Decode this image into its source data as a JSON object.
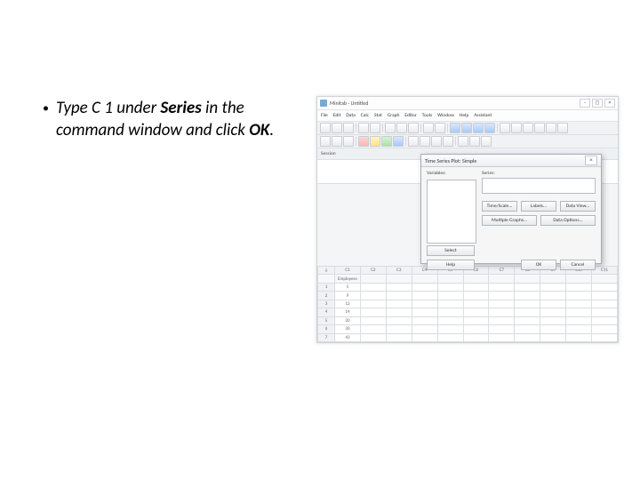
{
  "slide": {
    "bullet": {
      "pre": "Type C 1 under ",
      "bold1": "Series",
      "mid": " in the command window and click ",
      "bold2": "OK",
      "post": "."
    }
  },
  "app": {
    "title": "Minitab - Untitled",
    "menu": [
      "File",
      "Edit",
      "Data",
      "Calc",
      "Stat",
      "Graph",
      "Editor",
      "Tools",
      "Window",
      "Help",
      "Assistant"
    ],
    "session_label": "Session"
  },
  "worksheet": {
    "columns": [
      "C1",
      "C2",
      "C3",
      "C4",
      "C5",
      "C6",
      "C7",
      "C8",
      "C9",
      "C10",
      "C11"
    ],
    "var_names": [
      "Employees",
      "",
      "",
      "",
      "",
      "",
      "",
      "",
      "",
      "",
      ""
    ],
    "rows": [
      [
        "1",
        "5",
        "",
        "",
        "",
        "",
        "",
        "",
        "",
        "",
        "",
        ""
      ],
      [
        "2",
        "9",
        "",
        "",
        "",
        "",
        "",
        "",
        "",
        "",
        "",
        ""
      ],
      [
        "3",
        "12",
        "",
        "",
        "",
        "",
        "",
        "",
        "",
        "",
        "",
        ""
      ],
      [
        "4",
        "14",
        "",
        "",
        "",
        "",
        "",
        "",
        "",
        "",
        "",
        ""
      ],
      [
        "5",
        "20",
        "",
        "",
        "",
        "",
        "",
        "",
        "",
        "",
        "",
        ""
      ],
      [
        "6",
        "30",
        "",
        "",
        "",
        "",
        "",
        "",
        "",
        "",
        "",
        ""
      ],
      [
        "7",
        "43",
        "",
        "",
        "",
        "",
        "",
        "",
        "",
        "",
        "",
        ""
      ]
    ]
  },
  "dialog": {
    "title": "Time Series Plot: Simple",
    "listbox_label": "Variables:",
    "series_label": "Series:",
    "series_value": "",
    "buttons": {
      "timescale": "Time/Scale...",
      "labels": "Labels...",
      "dataview": "Data View...",
      "multgraph": "Multiple Graphs...",
      "dataopt": "Data Options...",
      "select": "Select",
      "help": "Help",
      "ok": "OK",
      "cancel": "Cancel"
    }
  }
}
